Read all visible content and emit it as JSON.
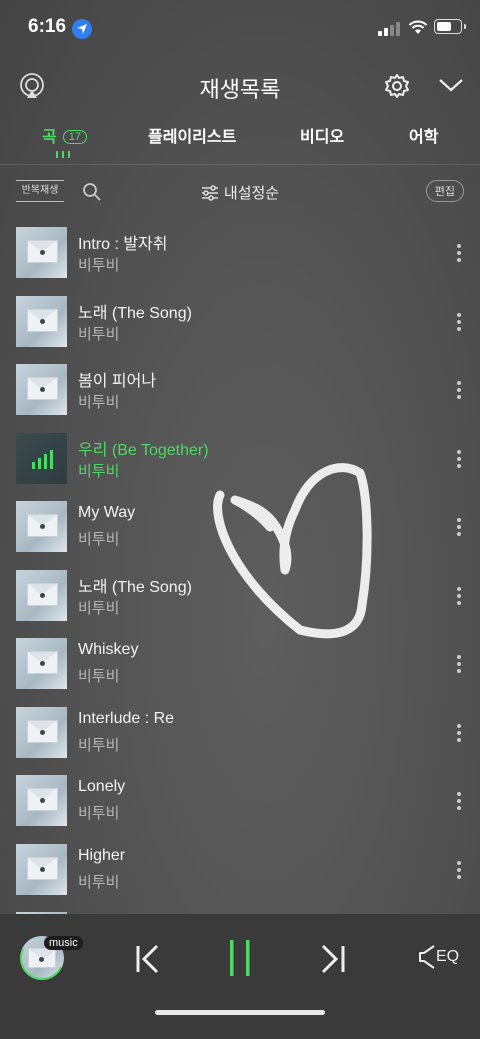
{
  "status": {
    "time": "6:16"
  },
  "header": {
    "title": "재생목록"
  },
  "tabs": [
    {
      "label": "곡",
      "badge": "17",
      "active": true
    },
    {
      "label": "플레이리스트"
    },
    {
      "label": "비디오"
    },
    {
      "label": "어학"
    }
  ],
  "toolbar": {
    "repeat_label": "반복재생",
    "sort_label": "내설정순",
    "edit_label": "편집"
  },
  "songs": [
    {
      "title": "Intro : 발자취",
      "artist": "비투비"
    },
    {
      "title": "노래 (The Song)",
      "artist": "비투비"
    },
    {
      "title": "봄이 피어나",
      "artist": "비투비"
    },
    {
      "title": "우리 (Be Together)",
      "artist": "비투비",
      "playing": true
    },
    {
      "title": "My Way",
      "artist": "비투비"
    },
    {
      "title": "노래 (The Song)",
      "artist": "비투비"
    },
    {
      "title": "Whiskey",
      "artist": "비투비"
    },
    {
      "title": "Interlude : Re",
      "artist": "비투비"
    },
    {
      "title": "Lonely",
      "artist": "비투비"
    },
    {
      "title": "Higher",
      "artist": "비투비"
    }
  ],
  "player": {
    "tag": "music",
    "eq_label": "EQ"
  },
  "colors": {
    "accent": "#4cd964",
    "player_bg": "#3a3a3a"
  },
  "icons": [
    "airplay-icon",
    "gear-icon",
    "chevron-down-icon",
    "search-icon",
    "sort-sliders-icon",
    "more-icon",
    "previous-icon",
    "pause-icon",
    "next-icon",
    "eq-speaker-icon"
  ]
}
